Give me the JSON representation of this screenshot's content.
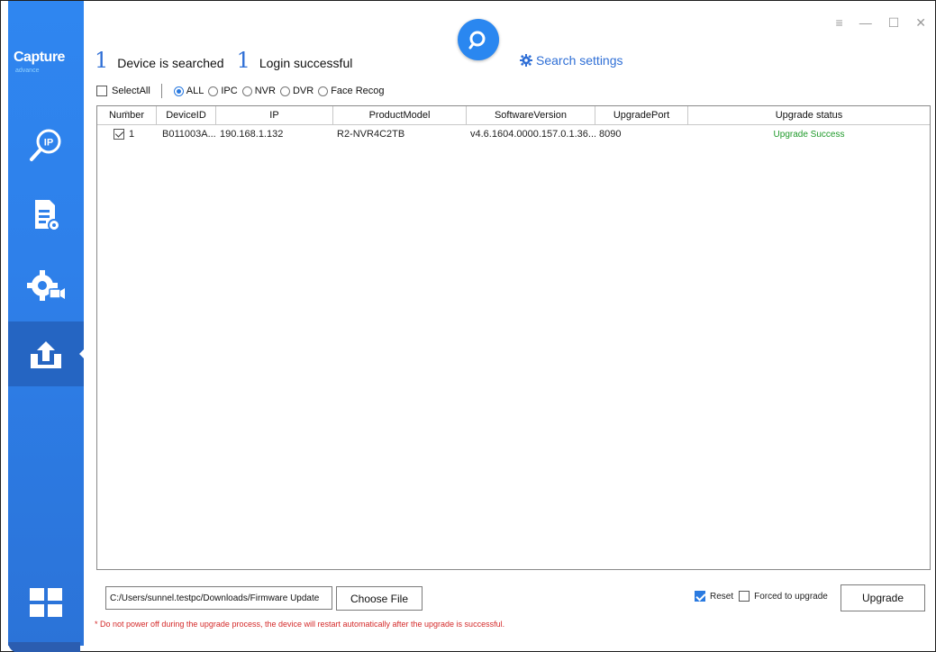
{
  "logo": {
    "text": "Capture",
    "sub": "advance"
  },
  "window_controls": {
    "menu": "≡",
    "minimize": "—",
    "maximize": "☐",
    "close": "✕"
  },
  "header": {
    "searched_count": "1",
    "searched_label": "Device is searched",
    "login_count": "1",
    "login_label": "Login successful",
    "search_settings_label": "Search settings"
  },
  "filter": {
    "select_all": "SelectAll",
    "options": [
      "ALL",
      "IPC",
      "NVR",
      "DVR",
      "Face Recog"
    ],
    "selected": "ALL"
  },
  "table": {
    "columns": [
      "Number",
      "DeviceID",
      "IP",
      "ProductModel",
      "SoftwareVersion",
      "UpgradePort",
      "Upgrade status"
    ],
    "rows": [
      {
        "number": "1",
        "device_id": "B011003A...",
        "ip": "190.168.1.132",
        "product_model": "R2-NVR4C2TB",
        "software_version": "v4.6.1604.0000.157.0.1.36....",
        "upgrade_port": "8090",
        "upgrade_status": "Upgrade Success"
      }
    ]
  },
  "bottom": {
    "file_path": "C:/Users/sunnel.testpc/Downloads/Firmware Update",
    "choose_file_label": "Choose File",
    "reset_label": "Reset",
    "reset_checked": true,
    "forced_label": "Forced to upgrade",
    "forced_checked": false,
    "upgrade_label": "Upgrade",
    "warning": "* Do not power off during the upgrade process, the device will restart automatically after the upgrade is successful."
  },
  "colors": {
    "sidebar": "#2f86f0",
    "sidebar_active": "#2565c2",
    "accent": "#2f6fd6",
    "success": "#1f9a2a",
    "warning": "#d42a2a"
  }
}
